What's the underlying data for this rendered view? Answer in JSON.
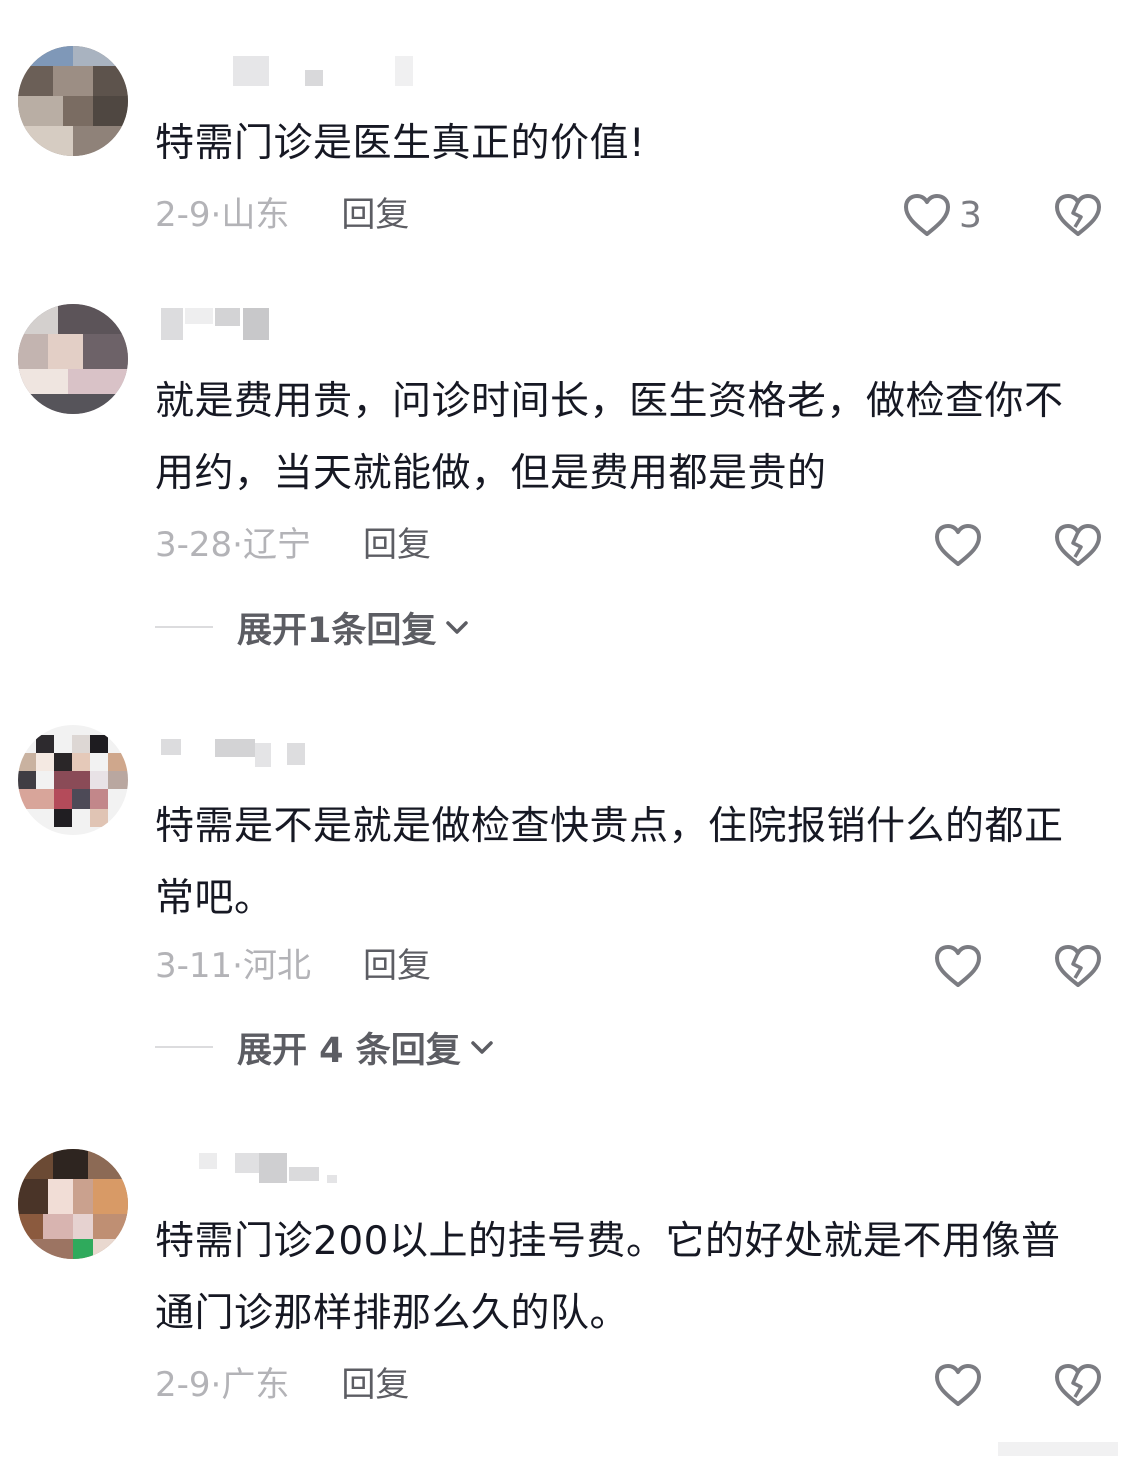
{
  "comments": [
    {
      "text": "特需门诊是医生真正的价值!",
      "date": "2-9",
      "location": "山东",
      "reply_label": "回复",
      "like_count": "3",
      "expand_label": ""
    },
    {
      "text": "就是费用贵，问诊时间长，医生资格老，做检查你不用约，当天就能做，但是费用都是贵的",
      "date": "3-28",
      "location": "辽宁",
      "reply_label": "回复",
      "like_count": "",
      "expand_label": "展开1条回复"
    },
    {
      "text": "特需是不是就是做检查快贵点，住院报销什么的都正常吧。",
      "date": "3-11",
      "location": "河北",
      "reply_label": "回复",
      "like_count": "",
      "expand_label": "展开 4 条回复"
    },
    {
      "text": "特需门诊200以上的挂号费。它的好处就是不用像普通门诊那样排那么久的队。",
      "date": "2-9",
      "location": "广东",
      "reply_label": "回复",
      "like_count": "",
      "expand_label": ""
    }
  ],
  "icons": {
    "like": "heart-outline-icon",
    "dislike": "broken-heart-icon",
    "expand": "chevron-down-icon"
  },
  "colors": {
    "text": "#161823",
    "meta": "#b3b3b7",
    "action": "#5c5d63",
    "icon": "#7b7c82"
  }
}
